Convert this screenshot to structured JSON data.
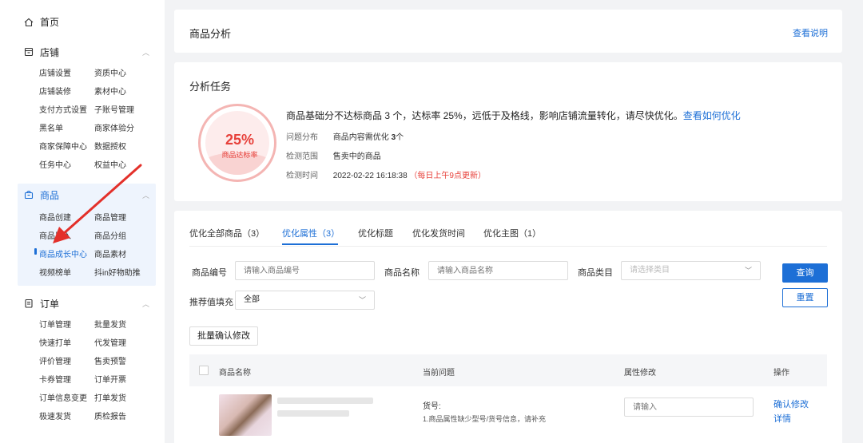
{
  "sidebar": {
    "home": "首页",
    "store": {
      "title": "店铺",
      "items": [
        "店铺设置",
        "资质中心",
        "店铺装修",
        "素材中心",
        "支付方式设置",
        "子账号管理",
        "黑名单",
        "商家体验分",
        "商家保障中心",
        "数据授权",
        "任务中心",
        "权益中心"
      ]
    },
    "goods": {
      "title": "商品",
      "items": [
        "商品创建",
        "商品管理",
        "商品导入",
        "商品分组",
        "商品成长中心",
        "商品素材",
        "视频榜单",
        "抖in好物助推"
      ]
    },
    "orders": {
      "title": "订单",
      "items": [
        "订单管理",
        "批量发货",
        "快速打单",
        "代发管理",
        "评价管理",
        "售卖预警",
        "卡券管理",
        "订单开票",
        "订单信息变更",
        "打单发货",
        "极速发货",
        "质检报告"
      ]
    }
  },
  "header": {
    "title": "商品分析",
    "help": "查看说明"
  },
  "task": {
    "title": "分析任务",
    "percent": "25%",
    "percent_label": "商品达标率",
    "summary": "商品基础分不达标商品 3 个，达标率 25%，远低于及格线，影响店铺流量转化，请尽快优化。",
    "summary_link": "查看如何优化",
    "dist_label": "问题分布",
    "dist_value": "商品内容需优化",
    "dist_count": "3",
    "dist_unit": "个",
    "scope_label": "检测范围",
    "scope_value": "售卖中的商品",
    "time_label": "检测时间",
    "time_value": "2022-02-22 16:18:38",
    "time_note": "（每日上午9点更新）"
  },
  "tabs": [
    "优化全部商品（3）",
    "优化属性（3）",
    "优化标题",
    "优化发货时间",
    "优化主图（1）"
  ],
  "filters": {
    "code_label": "商品编号",
    "code_placeholder": "请输入商品编号",
    "name_label": "商品名称",
    "name_placeholder": "请输入商品名称",
    "cat_label": "商品类目",
    "cat_placeholder": "请选择类目",
    "rec_label": "推荐值填充",
    "rec_value": "全部",
    "query": "查询",
    "reset": "重置",
    "batch": "批量确认修改"
  },
  "table": {
    "columns": [
      "商品名称",
      "当前问题",
      "属性修改",
      "操作"
    ],
    "rows": [
      {
        "issue_title": "货号:",
        "issue_desc": "1.商品属性缺少型号/货号信息，请补充",
        "input_placeholder": "请输入",
        "action_confirm": "确认修改",
        "action_detail": "详情"
      }
    ]
  }
}
